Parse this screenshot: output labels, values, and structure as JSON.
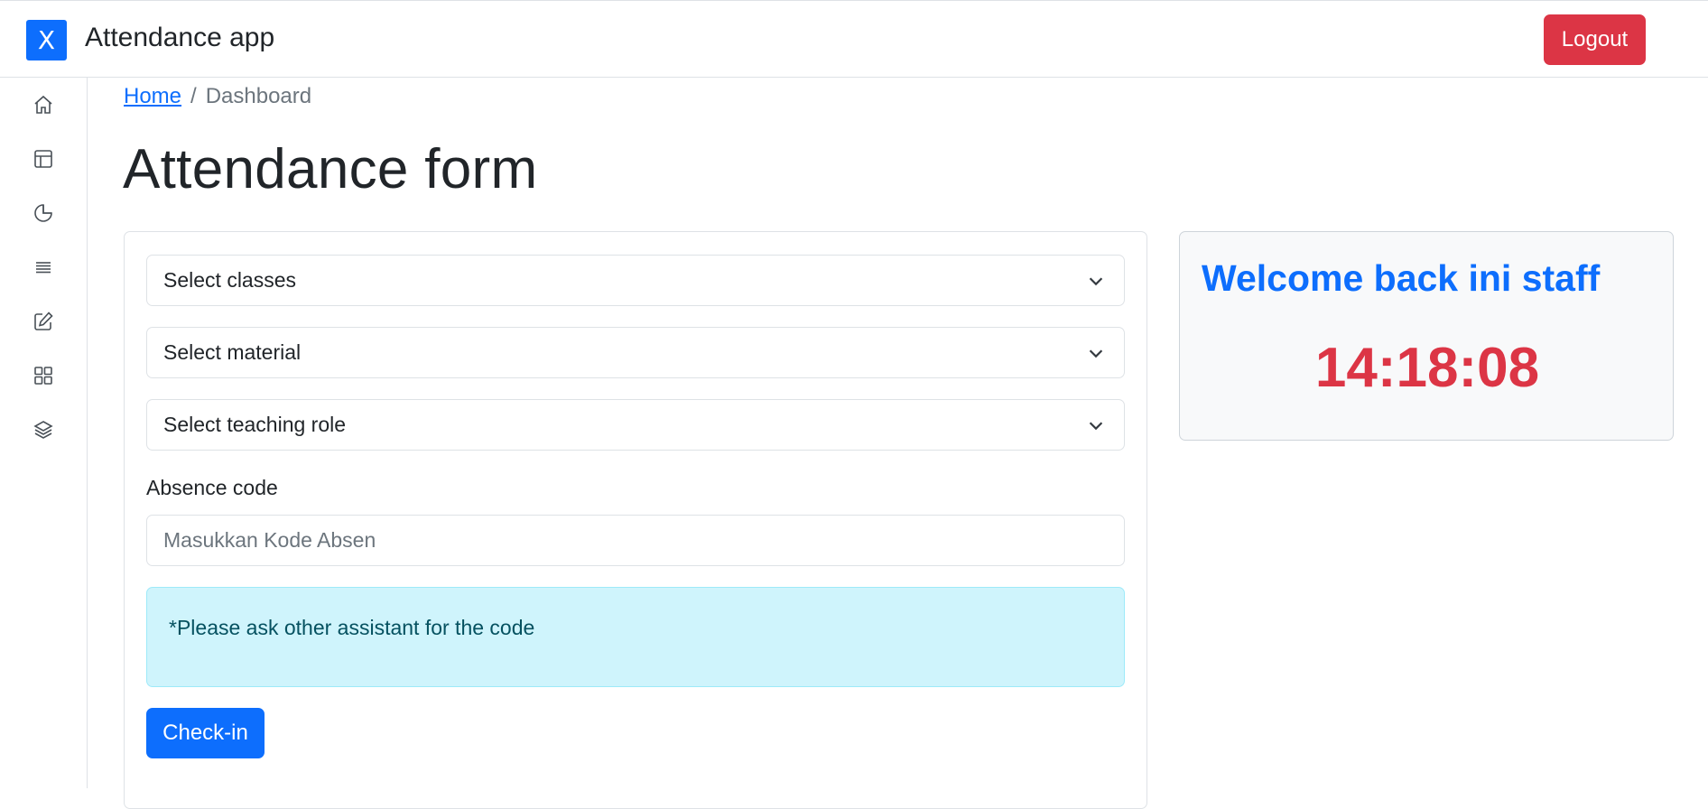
{
  "app": {
    "logo_letter": "X",
    "name": "Attendance app",
    "logout_label": "Logout"
  },
  "sidebar": {
    "icons": [
      "home-icon",
      "layout-icon",
      "pie-chart-icon",
      "list-icon",
      "edit-icon",
      "grid-icon",
      "layers-icon"
    ]
  },
  "breadcrumb": {
    "home": "Home",
    "separator": "/",
    "current": "Dashboard"
  },
  "page": {
    "title": "Attendance form"
  },
  "form": {
    "select_classes": "Select classes",
    "select_material": "Select material",
    "select_role": "Select teaching role",
    "absence_label": "Absence code",
    "absence_placeholder": "Masukkan Kode Absen",
    "absence_value": "",
    "alert_text": "*Please ask other assistant for the code",
    "checkin_label": "Check-in"
  },
  "welcome": {
    "title": "Welcome back ini staff",
    "time": "14:18:08"
  },
  "colors": {
    "primary": "#0d6efd",
    "danger": "#dc3545",
    "info_bg": "#cff4fc",
    "info_text": "#055160"
  }
}
